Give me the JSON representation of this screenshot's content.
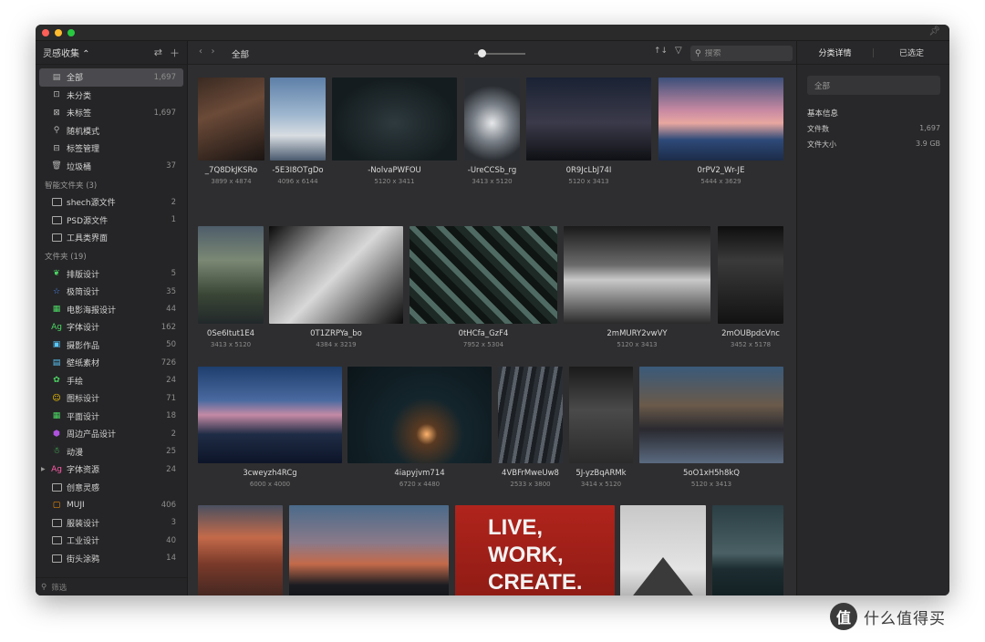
{
  "sidebar": {
    "title": "灵感收集",
    "items": [
      {
        "label": "全部",
        "count": "1,697",
        "active": true
      },
      {
        "label": "未分类",
        "count": ""
      },
      {
        "label": "未标签",
        "count": "1,697"
      },
      {
        "label": "随机模式",
        "count": ""
      },
      {
        "label": "标签管理",
        "count": ""
      },
      {
        "label": "垃圾桶",
        "count": "37"
      }
    ],
    "smart_section": "智能文件夹 (3)",
    "smart_items": [
      {
        "label": "shech源文件",
        "count": "2"
      },
      {
        "label": "PSD源文件",
        "count": "1"
      },
      {
        "label": "工具类界面",
        "count": ""
      }
    ],
    "folder_section": "文件夹 (19)",
    "folders": [
      {
        "label": "排版设计",
        "count": "5",
        "icon": "leaf-icon",
        "color": "#4cd964"
      },
      {
        "label": "极简设计",
        "count": "35",
        "icon": "star-icon",
        "color": "#4a90ff"
      },
      {
        "label": "电影海报设计",
        "count": "44",
        "icon": "film-icon",
        "color": "#4cd964"
      },
      {
        "label": "字体设计",
        "count": "162",
        "icon": "ag-icon",
        "color": "#4cd964"
      },
      {
        "label": "摄影作品",
        "count": "50",
        "icon": "photo-icon",
        "color": "#5ac8fa"
      },
      {
        "label": "壁纸素材",
        "count": "726",
        "icon": "wallpaper-icon",
        "color": "#5ac8fa"
      },
      {
        "label": "手绘",
        "count": "24",
        "icon": "palette-icon",
        "color": "#4cd964"
      },
      {
        "label": "图标设计",
        "count": "71",
        "icon": "smiley-icon",
        "color": "#ffcc00"
      },
      {
        "label": "平面设计",
        "count": "18",
        "icon": "grid-icon",
        "color": "#4cd964"
      },
      {
        "label": "周边产品设计",
        "count": "2",
        "icon": "box-icon",
        "color": "#af52de"
      },
      {
        "label": "动漫",
        "count": "25",
        "icon": "character-icon",
        "color": "#4cd964"
      },
      {
        "label": "字体资源",
        "count": "24",
        "icon": "ag-icon",
        "color": "#ff5ba8",
        "expandable": true
      },
      {
        "label": "创意灵感",
        "count": "",
        "icon": "folder-icon",
        "color": "#a9a9a9"
      },
      {
        "label": "MUJI",
        "count": "406",
        "icon": "muji-icon",
        "color": "#ff9500"
      },
      {
        "label": "服装设计",
        "count": "3",
        "icon": "folder-icon",
        "color": "#a9a9a9"
      },
      {
        "label": "工业设计",
        "count": "40",
        "icon": "folder-icon",
        "color": "#a9a9a9"
      },
      {
        "label": "街头涂鸦",
        "count": "14",
        "icon": "folder-icon",
        "color": "#a9a9a9"
      }
    ],
    "filter_placeholder": "筛选"
  },
  "toolbar": {
    "title": "全部",
    "search_placeholder": "搜索",
    "zoom_level": 0.15
  },
  "thumbnails": [
    {
      "name": "_7Q8DkJKSRo",
      "dims": "3899 x 4874"
    },
    {
      "name": "-5E3I8OTgDo",
      "dims": "4096 x 6144"
    },
    {
      "name": "-NolvaPWFOU",
      "dims": "5120 x 3411"
    },
    {
      "name": "-UreCCSb_rg",
      "dims": "3413 x 5120"
    },
    {
      "name": "0R9JcLbJ74I",
      "dims": "5120 x 3413"
    },
    {
      "name": "0rPV2_Wr-JE",
      "dims": "5444 x 3629"
    },
    {
      "name": "0Se6Itut1E4",
      "dims": "3413 x 5120"
    },
    {
      "name": "0T1ZRPYa_bo",
      "dims": "4384 x 3219"
    },
    {
      "name": "0tHCfa_GzF4",
      "dims": "7952 x 5304"
    },
    {
      "name": "2mMURY2vwVY",
      "dims": "5120 x 3413"
    },
    {
      "name": "2mOUBpdcVnc",
      "dims": "3452 x 5178"
    },
    {
      "name": "3cweyzh4RCg",
      "dims": "6000 x 4000"
    },
    {
      "name": "4iapyjvm714",
      "dims": "6720 x 4480"
    },
    {
      "name": "4VBFrMweUw8",
      "dims": "2533 x 3800"
    },
    {
      "name": "5J-yzBqARMk",
      "dims": "3414 x 5120"
    },
    {
      "name": "5oO1xH5h8kQ",
      "dims": "5120 x 3413"
    },
    {
      "name": "",
      "dims": ""
    },
    {
      "name": "",
      "dims": ""
    },
    {
      "name": "",
      "dims": ""
    },
    {
      "name": "",
      "dims": ""
    },
    {
      "name": "",
      "dims": ""
    }
  ],
  "poster_text": "LIVE,\nWORK,\nCREATE.",
  "right_panel": {
    "tab_details": "分类详情",
    "tab_selected": "已选定",
    "current_folder": "全部",
    "basic_info_title": "基本信息",
    "file_count_label": "文件数",
    "file_count": "1,697",
    "file_size_label": "文件大小",
    "file_size": "3.9 GB"
  },
  "watermark": {
    "logo": "值",
    "text": "什么值得买"
  },
  "colors": {
    "window_bg": "#2c2c2e",
    "sidebar_bg": "#252527",
    "active_item": "#4a4a4e",
    "close": "#ff5f57",
    "minimize": "#febc2e",
    "zoom": "#28c840"
  }
}
